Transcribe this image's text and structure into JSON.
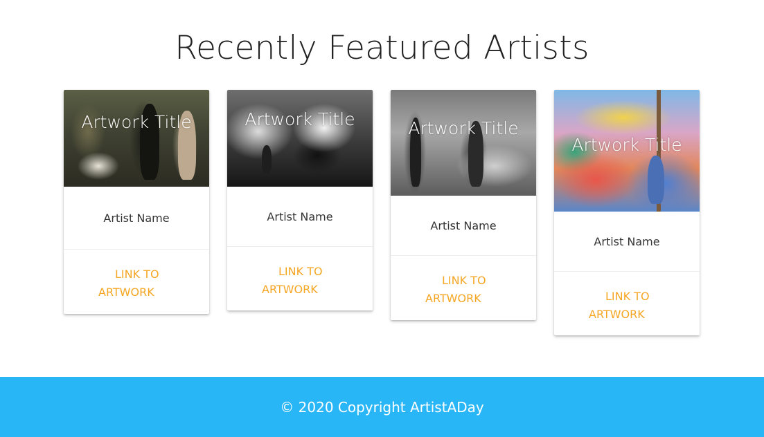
{
  "section": {
    "title": "Recently Featured Artists"
  },
  "cards": [
    {
      "image_alt": "Artwork image",
      "artwork_title": "Artwork Title",
      "artist_name": "Artist Name",
      "link_label": "LINK TO ARTWORK"
    },
    {
      "image_alt": "Artwork image",
      "artwork_title": "Artwork Title",
      "artist_name": "Artist Name",
      "link_label": "LINK TO ARTWORK"
    },
    {
      "image_alt": "Artwork image",
      "artwork_title": "Artwork Title",
      "artist_name": "Artist Name",
      "link_label": "LINK TO ARTWORK"
    },
    {
      "image_alt": "Artwork image",
      "artwork_title": "Artwork Title",
      "artist_name": "Artist Name",
      "link_label": "LINK TO ARTWORK"
    }
  ],
  "footer": {
    "copyright": "© 2020 Copyright ArtistADay"
  },
  "colors": {
    "link": "#f5a623",
    "footer_background": "#29b6f6",
    "heading_text": "#222222"
  }
}
